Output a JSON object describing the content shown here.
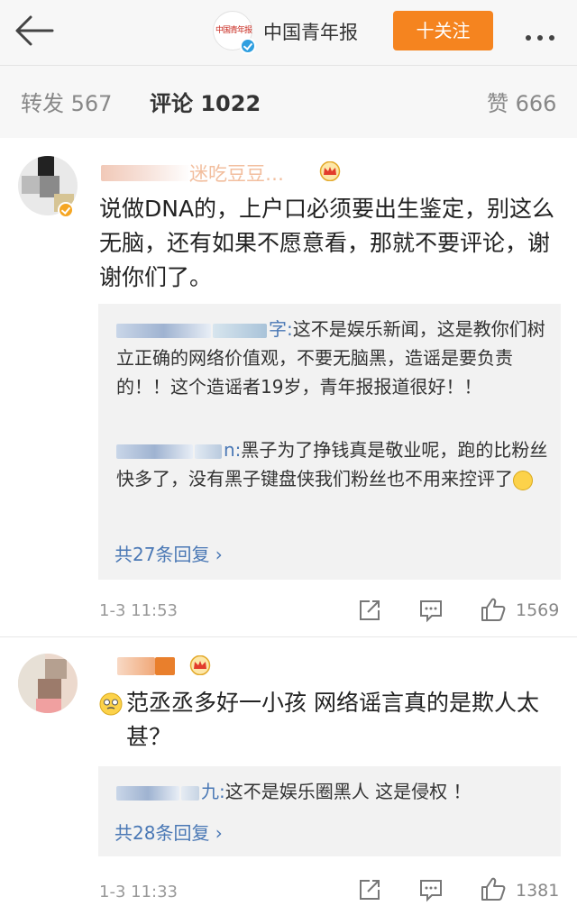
{
  "topbar": {
    "account_name": "中国青年报",
    "logo_text": "中国青年报",
    "follow_label": "十关注"
  },
  "tabs": [
    {
      "label": "转发 567"
    },
    {
      "label": "评论 1022"
    },
    {
      "label": "赞 666"
    }
  ],
  "comments": [
    {
      "name_tail": "迷吃豆豆…",
      "text": "说做DNA的，上户口必须要出生鉴定，别这么无脑，还有如果不愿意看，那就不要评论，谢谢你们了。",
      "replies": [
        {
          "name_tail": "字:",
          "text": "这不是娱乐新闻，这是教你们树立正确的网络价值观，不要无脑黑，造谣是要负责的！！这个造谣者19岁，青年报报道很好！！"
        },
        {
          "name_tail": "n:",
          "text": "黑子为了挣钱真是敬业呢，跑的比粉丝快多了，没有黑子键盘侠我们粉丝也不用来控评了"
        }
      ],
      "more_replies": "共27条回复",
      "time": "1-3 11:53",
      "likes": "1569"
    },
    {
      "text": "范丞丞多好一小孩  网络谣言真的是欺人太甚？",
      "replies": [
        {
          "name_tail": "九:",
          "text": "这不是娱乐圈黑人   这是侵权  ！"
        }
      ],
      "more_replies": "共28条回复",
      "time": "1-3 11:33",
      "likes": "1381"
    }
  ],
  "icons": {
    "back": "arrow-left-icon",
    "more": "more-dots-icon",
    "crown": "crown-badge-icon",
    "verified": "verified-badge-icon",
    "share": "share-icon",
    "comment": "comment-icon",
    "like": "thumbs-up-icon"
  },
  "colors": {
    "follow_button": "#f5841f",
    "link_blue": "#4a78b5",
    "reply_background": "#f2f2f2"
  }
}
